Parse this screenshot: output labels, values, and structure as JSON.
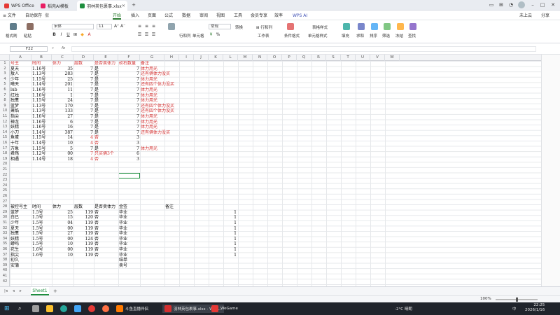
{
  "titlebar": {
    "tabs": [
      {
        "label": "WPS Office",
        "color": "#e53935"
      },
      {
        "label": "稻壳AI模板",
        "color": "#e91e63"
      },
      {
        "label": "羽林英包裹事.xlsx",
        "color": "#1e8e3e"
      }
    ],
    "plus": "+",
    "right_icons": [
      "monitor-icon",
      "grid-icon",
      "bell-icon",
      "avatar"
    ]
  },
  "menubar": {
    "items": [
      "≡ 文件",
      "自动保存",
      "撤",
      "开始",
      "插入",
      "页面",
      "公式",
      "数据",
      "审阅",
      "视图",
      "工具",
      "会员专享",
      "效率",
      "WPS AI"
    ],
    "active": "开始",
    "right": [
      "未上云",
      "分享"
    ]
  },
  "ribbon": {
    "labels": [
      "格式刷",
      "粘贴",
      "宋体",
      "11",
      "A⁺",
      "A⁻",
      "B",
      "I",
      "U",
      "A",
      "行和列",
      "单元格",
      "常规",
      "转换",
      "工作表",
      "条件格式",
      "单元格样式",
      "表格样式",
      "填充",
      "求和",
      "排序",
      "筛选",
      "冻结",
      "查找"
    ],
    "font_name": "宋体",
    "font_size": "11",
    "number_format": "常规"
  },
  "formulabar": {
    "name_box": "F22",
    "fx": "fx",
    "value": ""
  },
  "columns": [
    "A",
    "B",
    "C",
    "D",
    "E",
    "F",
    "G",
    "H",
    "I",
    "J",
    "K",
    "L",
    "M",
    "N",
    "O",
    "P",
    "Q",
    "R",
    "S",
    "T",
    "U",
    "V",
    "W"
  ],
  "rows_count": 42,
  "sheet1": {
    "headers": [
      "号主",
      "时间",
      "体力",
      "层数",
      "是否卖体力",
      "砍石数量",
      "备注"
    ],
    "rows": [
      [
        "夏天",
        "1.16号",
        "35",
        "7",
        "是",
        "7",
        "体力用光"
      ],
      [
        "敖人",
        "1.13号",
        "283",
        "7",
        "是",
        "7",
        "还有俩体力没买"
      ],
      [
        "少年",
        "1.15号",
        "25",
        "7",
        "是",
        "7",
        "体力用光"
      ],
      [
        "曦天",
        "1.14号",
        "201",
        "7",
        "是",
        "7",
        "还有四个体力没买"
      ],
      [
        "lub",
        "1.16号",
        "11",
        "7",
        "是",
        "7",
        "体力用光"
      ],
      [
        "红烛",
        "1.16号",
        "1",
        "7",
        "是",
        "7",
        "体力用光"
      ],
      [
        "独薰",
        "1.15号",
        "24",
        "7",
        "是",
        "7",
        "体力用光"
      ],
      [
        "蓝梦",
        "1.13号",
        "170",
        "7",
        "是",
        "7",
        "还有四个体力没买"
      ],
      [
        "萧焰",
        "1.13号",
        "133",
        "7",
        "是",
        "7",
        "还有四个体力没买"
      ],
      [
        "指尖",
        "1.16号",
        "27",
        "7",
        "是",
        "7",
        "体力用光"
      ],
      [
        "禅龙",
        "1.16号",
        "6",
        "7",
        "是",
        "7",
        "体力用光"
      ],
      [
        "妖精",
        "1.16号",
        "16",
        "7",
        "是",
        "7",
        "体力用光"
      ],
      [
        "小刀",
        "1.14号",
        "387",
        "7",
        "是",
        "7",
        "还有俩体力没买"
      ],
      [
        "鱼蛋",
        "1.15号",
        "14",
        "4",
        "否",
        "3",
        ""
      ],
      [
        "十年",
        "1.14号",
        "10",
        "4",
        "否",
        "3",
        ""
      ],
      [
        "万象",
        "1.15号",
        "5",
        "7",
        "是",
        "7",
        "体力用光"
      ],
      [
        "君殇",
        "1.12号",
        "00",
        "7",
        "只买俩3个",
        "6",
        ""
      ],
      [
        "相遇",
        "1.14号",
        "18",
        "4",
        "否",
        "3",
        ""
      ]
    ],
    "red_rows": [
      13,
      14,
      16,
      17
    ]
  },
  "sheet2": {
    "headers": [
      "被控号主",
      "时间",
      "体力",
      "层数",
      "是否卖体力",
      "金签",
      "备注"
    ],
    "rows": [
      [
        "蓝梦",
        "1.5号",
        "25",
        "119",
        "否",
        "毕业",
        "1"
      ],
      [
        "白已",
        "1.5号",
        "15",
        "120",
        "否",
        "毕业",
        "1"
      ],
      [
        "少年",
        "1.5号",
        "04",
        "119",
        "否",
        "毕业",
        "1"
      ],
      [
        "夏天",
        "1.5号",
        "00",
        "119",
        "否",
        "毕业",
        "1"
      ],
      [
        "独薰",
        "1.5号",
        "27",
        "119",
        "否",
        "毕业",
        "1"
      ],
      [
        "妖精",
        "1.5号",
        "00",
        "124",
        "否",
        "毕业",
        "1"
      ],
      [
        "蟒鸣",
        "1.5号",
        "10",
        "119",
        "否",
        "毕业",
        "1"
      ],
      [
        "花生",
        "1.6号",
        "00",
        "119",
        "否",
        "毕业",
        "1"
      ],
      [
        "指尖",
        "1.6号",
        "10",
        "119",
        "否",
        "毕业",
        "1"
      ],
      [
        "初久",
        "",
        "",
        "",
        "",
        "结单",
        ""
      ],
      [
        "安蒲",
        "",
        "",
        "",
        "",
        "卖号",
        ""
      ]
    ]
  },
  "sheetbar": {
    "sheet_name": "Sheet1",
    "add": "+"
  },
  "statusbar": {
    "zoom": "100%"
  },
  "taskbar": {
    "apps": [
      {
        "label": "斗鱼直播伴侣",
        "color": "#ff7a00"
      },
      {
        "label": "羽林英包裹事.xlsx - WPS...",
        "color": "#d32f2f"
      },
      {
        "label": "WeGame",
        "color": "#e53935"
      }
    ],
    "weather": "-2°C 晴朗",
    "ime": "中",
    "time": "22:25",
    "date": "2026/1/16"
  }
}
